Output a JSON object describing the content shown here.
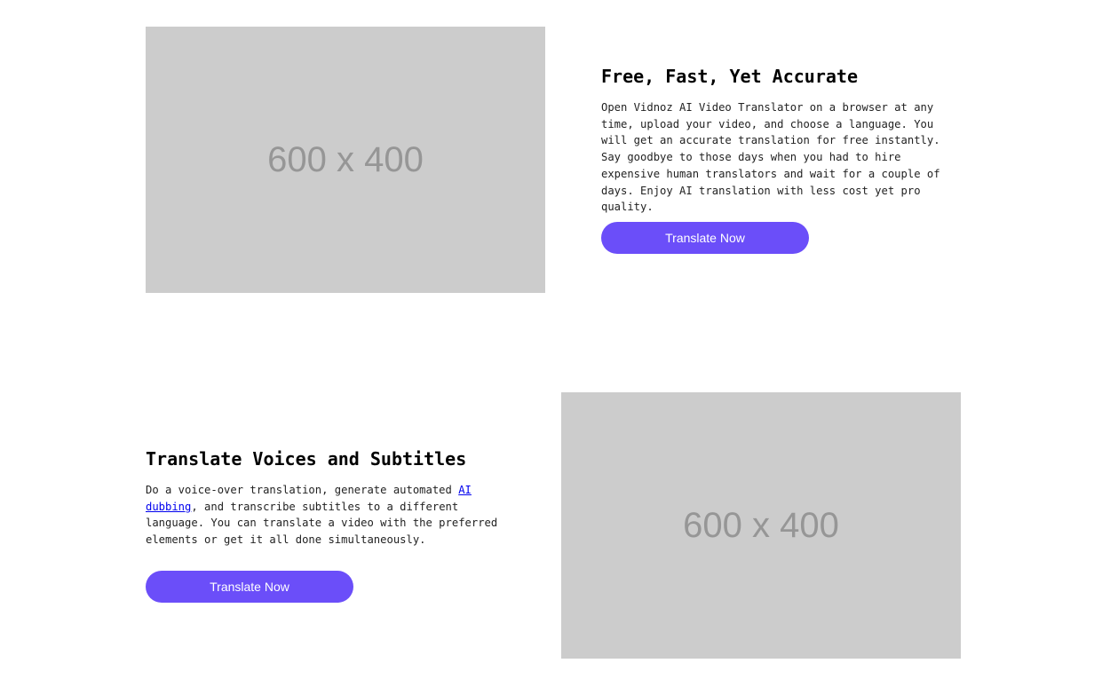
{
  "sections": [
    {
      "image_label": "600 x 400",
      "heading": "Free, Fast, Yet Accurate",
      "paragraph": "Open Vidnoz AI Video Translator on a browser at any time, upload your video, and choose a language. You will get an accurate translation for free instantly. Say goodbye to those days when you had to hire expensive human translators and wait for a couple of days. Enjoy AI translation with less cost yet pro quality.",
      "button_label": "Translate Now"
    },
    {
      "image_label": "600 x 400",
      "heading": "Translate Voices and Subtitles",
      "paragraph_before_link": "Do a voice-over translation, generate automated ",
      "link_text": "AI dubbing",
      "paragraph_after_link": ", and transcribe subtitles to a different language. You can translate a video with the preferred elements or get it all done simultaneously.",
      "button_label": "Translate Now"
    }
  ],
  "colors": {
    "button_bg": "#6b4ef9",
    "button_text": "#ffffff",
    "placeholder_bg": "#cccccc",
    "placeholder_text": "#969696",
    "link": "#0000ee"
  }
}
